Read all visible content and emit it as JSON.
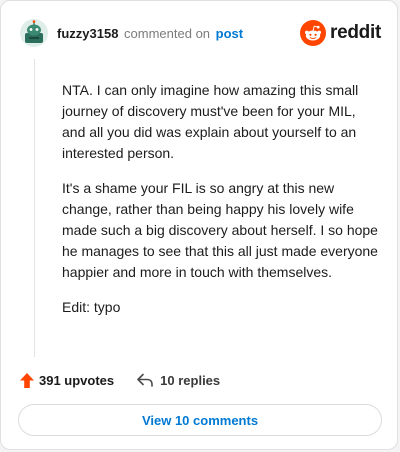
{
  "comment": {
    "username": "fuzzy3158",
    "action_text": "commented on",
    "post_link": "post",
    "avatar_icon": "snoo-avatar-icon",
    "brand": {
      "wordmark": "reddit",
      "icon": "reddit-snoo-logo-icon",
      "color": "#ff4500"
    },
    "body_paragraphs": [
      "NTA. I can only imagine how amazing this small journey of discovery must've been for your MIL, and all you did was explain about yourself to an interested person.",
      "It's a shame your FIL is so angry at this new change, rather than being happy his lovely wife made such a big discovery about herself. I so hope he manages to see that this all just made everyone happier and more in touch with themselves.",
      "Edit: typo"
    ]
  },
  "footer": {
    "upvotes": "391 upvotes",
    "upvote_icon": "upvote-arrow-icon",
    "replies": "10 replies",
    "reply_icon": "reply-arrow-icon"
  },
  "view_comments_label": "View 10 comments",
  "colors": {
    "accent": "#0079d3",
    "upvote": "#ff4500"
  }
}
